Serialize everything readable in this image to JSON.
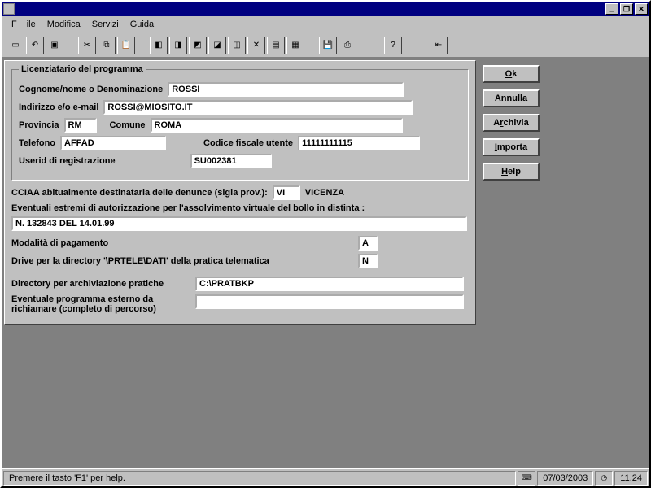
{
  "titlebar": {
    "title": ""
  },
  "menubar": {
    "file": "File",
    "modifica": "Modifica",
    "servizi": "Servizi",
    "guida": "Guida"
  },
  "fieldset": {
    "legend": "Licenziatario del programma",
    "labels": {
      "cognome": "Cognome/nome o Denominazione",
      "indirizzo": "Indirizzo e/o e-mail",
      "provincia": "Provincia",
      "comune": "Comune",
      "telefono": "Telefono",
      "codfisc": "Codice fiscale utente",
      "userid": "Userid di registrazione"
    },
    "values": {
      "cognome": "ROSSI",
      "indirizzo": "ROSSI@MIOSITO.IT",
      "provincia": "RM",
      "comune": "ROMA",
      "telefono": "AFFAD",
      "codfisc": "11111111115",
      "userid": "SU002381"
    }
  },
  "lower": {
    "cciaa_label": "CCIAA abitualmente destinataria delle denunce (sigla prov.):",
    "cciaa_value": "VI",
    "cciaa_name": "VICENZA",
    "bollo_label": "Eventuali estremi di autorizzazione per l'assolvimento virtuale del bollo in distinta :",
    "bollo_value": "N. 132843 DEL 14.01.99",
    "modalita_label": "Modalità di pagamento",
    "modalita_value": "A",
    "drive_label": "Drive per la directory '\\PRTELE\\DATI'  della pratica telematica",
    "drive_value": "N",
    "dirarch_label": "Directory per archiviazione pratiche",
    "dirarch_value": "C:\\PRATBKP",
    "extprog_label1": "Eventuale programma esterno da",
    "extprog_label2": "richiamare (completo di percorso)",
    "extprog_value": ""
  },
  "buttons": {
    "ok": "Ok",
    "annulla": "Annulla",
    "archivia": "Archivia",
    "importa": "Importa",
    "help": "Help"
  },
  "status": {
    "help": "Premere il tasto 'F1' per help.",
    "date": "07/03/2003",
    "time": "11.24"
  }
}
